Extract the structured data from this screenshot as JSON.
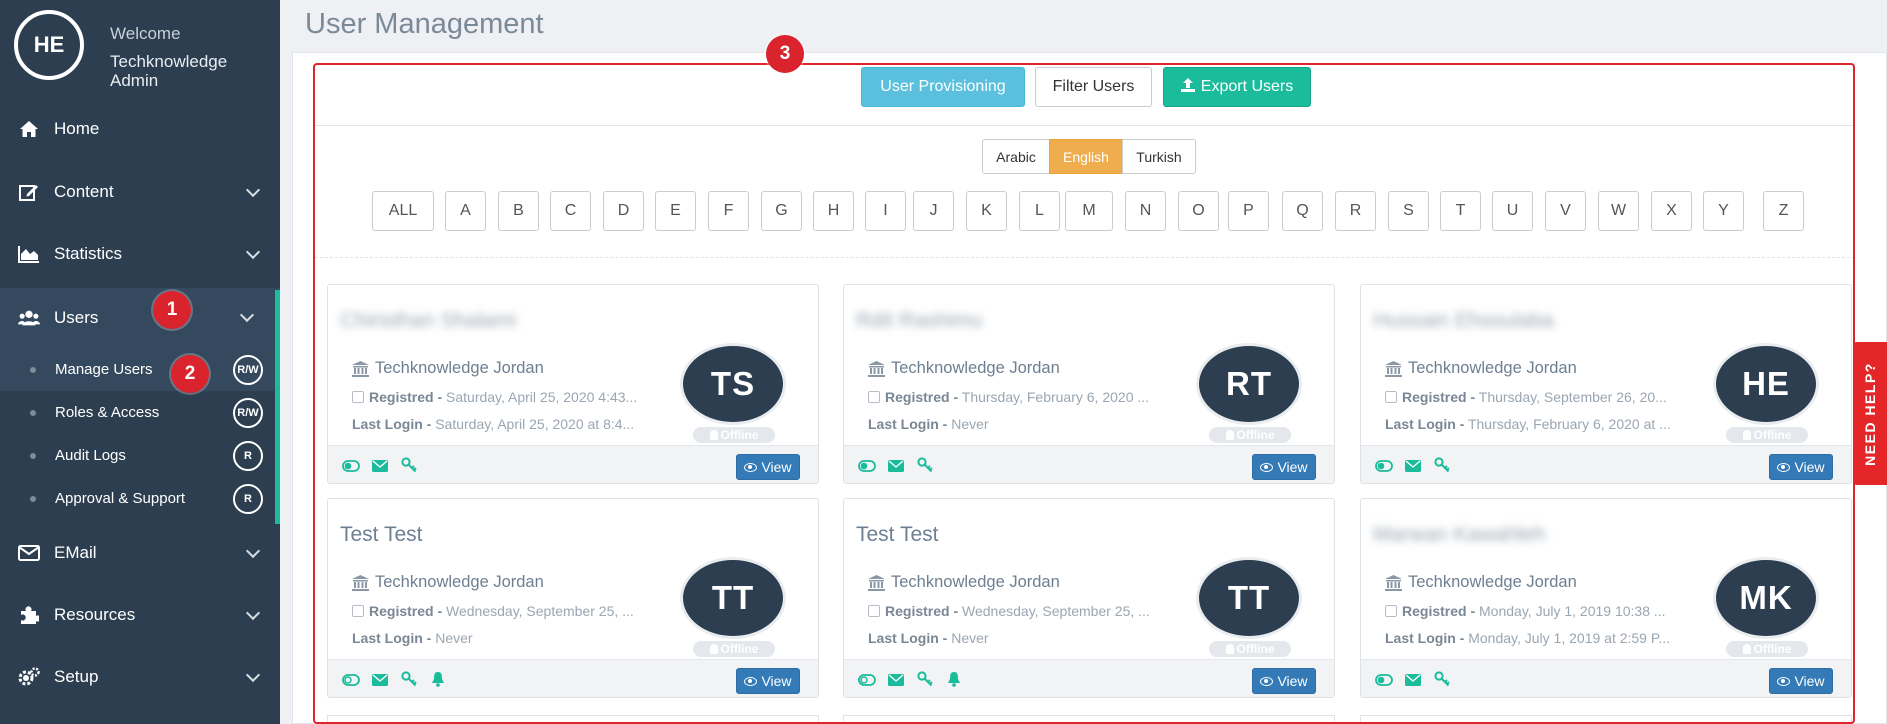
{
  "sidebar": {
    "avatar_initials": "HE",
    "welcome": "Welcome",
    "user_name": "Techknowledge Admin",
    "nav": {
      "home": "Home",
      "content": "Content",
      "statistics": "Statistics",
      "users": "Users",
      "email": "EMail",
      "resources": "Resources",
      "setup": "Setup"
    },
    "sub": [
      {
        "label": "Manage Users",
        "perm": "R/W"
      },
      {
        "label": "Roles & Access",
        "perm": "R/W"
      },
      {
        "label": "Audit Logs",
        "perm": "R"
      },
      {
        "label": "Approval & Support",
        "perm": "R"
      }
    ]
  },
  "markers": {
    "m1": "1",
    "m2": "2",
    "m3": "3"
  },
  "page_title": "User Management",
  "toolbar": {
    "provisioning": "User Provisioning",
    "filter": "Filter Users",
    "export": "Export Users"
  },
  "languages": [
    "Arabic",
    "English",
    "Turkish"
  ],
  "alphabet": [
    "ALL",
    "A",
    "B",
    "C",
    "D",
    "E",
    "F",
    "G",
    "H",
    "I",
    "J",
    "K",
    "L",
    "M",
    "N",
    "O",
    "P",
    "Q",
    "R",
    "S",
    "T",
    "U",
    "V",
    "W",
    "X",
    "Y",
    "Z"
  ],
  "cards": [
    {
      "name": "Chiristhan Shalami",
      "org": "Techknowledge Jordan",
      "reg_label": "Registred -",
      "reg": "Saturday, April 25, 2020 4:43...",
      "login_label": "Last Login -",
      "login": "Saturday, April 25, 2020 at 8:4...",
      "initials": "TS",
      "status": "Offline",
      "view": "View"
    },
    {
      "name": "Rdit Rashimu",
      "org": "Techknowledge Jordan",
      "reg_label": "Registred -",
      "reg": "Thursday, February 6, 2020 ...",
      "login_label": "Last Login -",
      "login": "Never",
      "initials": "RT",
      "status": "Offline",
      "view": "View"
    },
    {
      "name": "Hussain Ehsoulaba",
      "org": "Techknowledge Jordan",
      "reg_label": "Registred -",
      "reg": "Thursday, September 26, 20...",
      "login_label": "Last Login -",
      "login": "Thursday, February 6, 2020 at ...",
      "initials": "HE",
      "status": "Offline",
      "view": "View"
    },
    {
      "name": "Test Test",
      "org": "Techknowledge Jordan",
      "reg_label": "Registred -",
      "reg": "Wednesday, September 25, ...",
      "login_label": "Last Login -",
      "login": "Never",
      "initials": "TT",
      "status": "Offline",
      "view": "View"
    },
    {
      "name": "Test Test",
      "org": "Techknowledge Jordan",
      "reg_label": "Registred -",
      "reg": "Wednesday, September 25, ...",
      "login_label": "Last Login -",
      "login": "Never",
      "initials": "TT",
      "status": "Offline",
      "view": "View"
    },
    {
      "name": "Marwan Kawahleh",
      "org": "Techknowledge Jordan",
      "reg_label": "Registred -",
      "reg": "Monday, July 1, 2019 10:38 ...",
      "login_label": "Last Login -",
      "login": "Monday, July 1, 2019 at 2:59 P...",
      "initials": "MK",
      "status": "Offline",
      "view": "View"
    }
  ],
  "help": "NEED HELP?",
  "colors": {
    "sidebar": "#2c3e50",
    "accent": "#1abc9c",
    "marker": "#d9232d",
    "primary": "#337ab7",
    "info": "#5bc0de",
    "warning": "#f0ad4e"
  }
}
